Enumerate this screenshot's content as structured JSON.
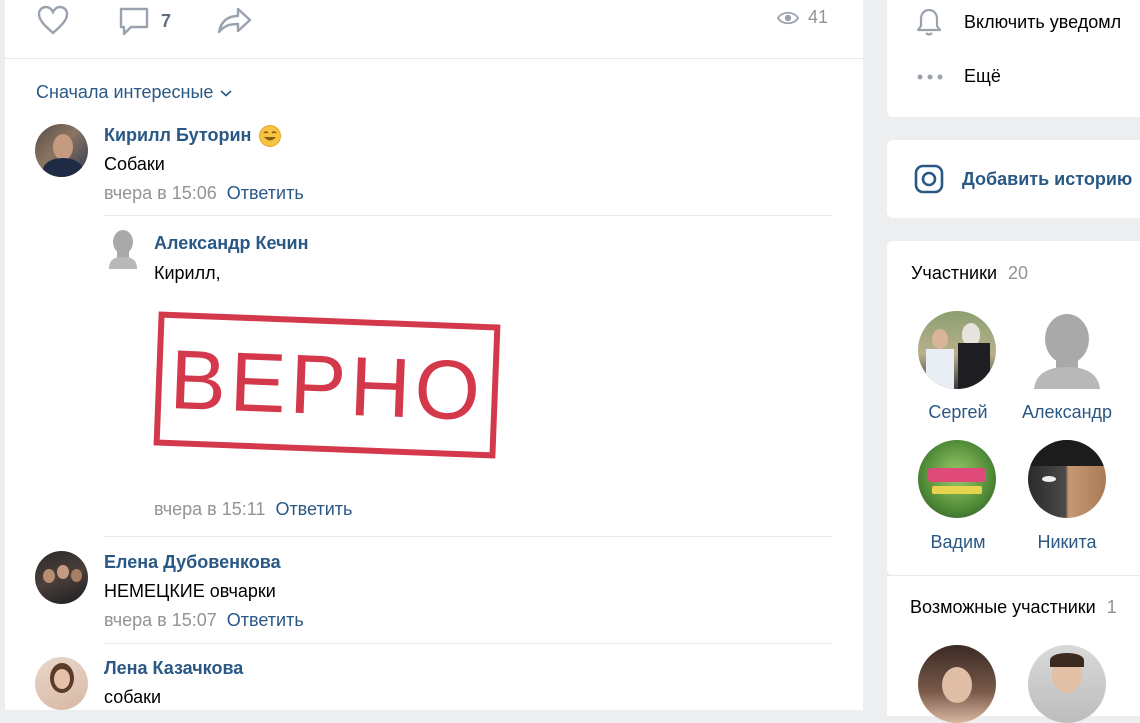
{
  "post_actions": {
    "comments_count": "7",
    "views_count": "41"
  },
  "sort": {
    "label": "Сначала интересные"
  },
  "comments": [
    {
      "author": "Кирилл Буторин",
      "text": "Собаки",
      "time": "вчера в 15:06",
      "reply_label": "Ответить"
    },
    {
      "author": "Александр Кечин",
      "text": "Кирилл,",
      "stamp_text": "ВЕРНО",
      "time": "вчера в 15:11",
      "reply_label": "Ответить"
    },
    {
      "author": "Елена Дубовенкова",
      "text": "НЕМЕЦКИЕ овчарки",
      "time": "вчера в 15:07",
      "reply_label": "Ответить"
    },
    {
      "author": "Лена Казачкова",
      "text": "собаки"
    }
  ],
  "sidebar": {
    "notify_label": "Включить уведомл",
    "more_label": "Ещё",
    "add_story_label": "Добавить историю",
    "members_title": "Участники",
    "members_count": "20",
    "members": [
      {
        "name": "Сергей"
      },
      {
        "name": "Александр"
      },
      {
        "name": "Вадим"
      },
      {
        "name": "Никита"
      }
    ],
    "possible_title": "Возможные участники",
    "possible_count": "1"
  },
  "colors": {
    "link": "#2a5885",
    "muted": "#939393",
    "stamp": "#d0293b",
    "background": "#edeef0"
  }
}
